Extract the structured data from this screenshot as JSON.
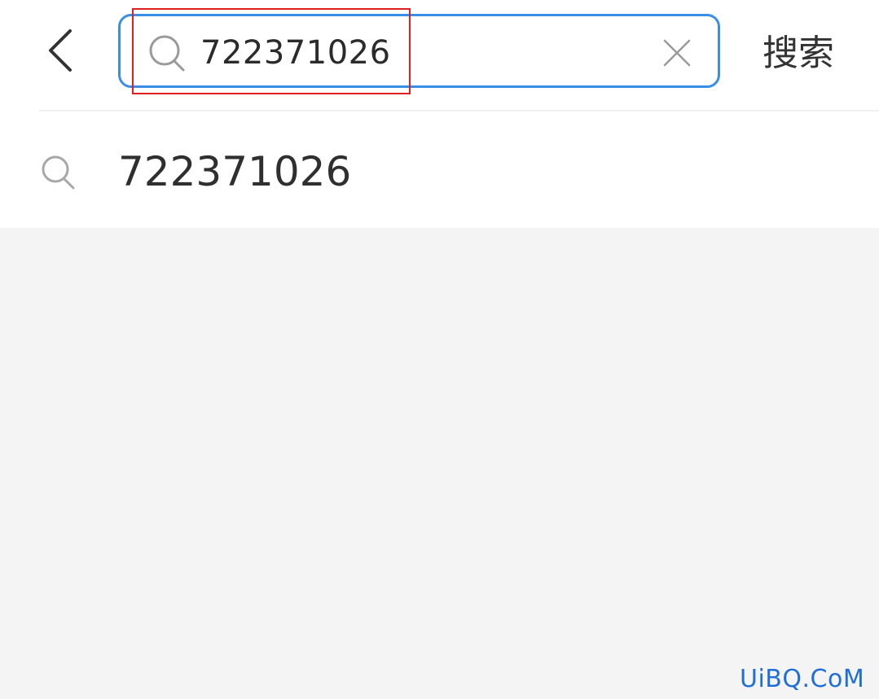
{
  "header": {
    "back_icon": "chevron-left-icon",
    "search": {
      "value": "722371026",
      "icon": "search-icon",
      "clear_icon": "close-icon"
    },
    "search_button_label": "搜索"
  },
  "suggestions": [
    {
      "icon": "search-icon",
      "text": "722371026"
    }
  ],
  "watermark": "UiBQ.CoM",
  "colors": {
    "accent": "#3a8ee6",
    "highlight": "#e02020",
    "background": "#f4f4f4",
    "watermark": "#1f6fd6"
  }
}
